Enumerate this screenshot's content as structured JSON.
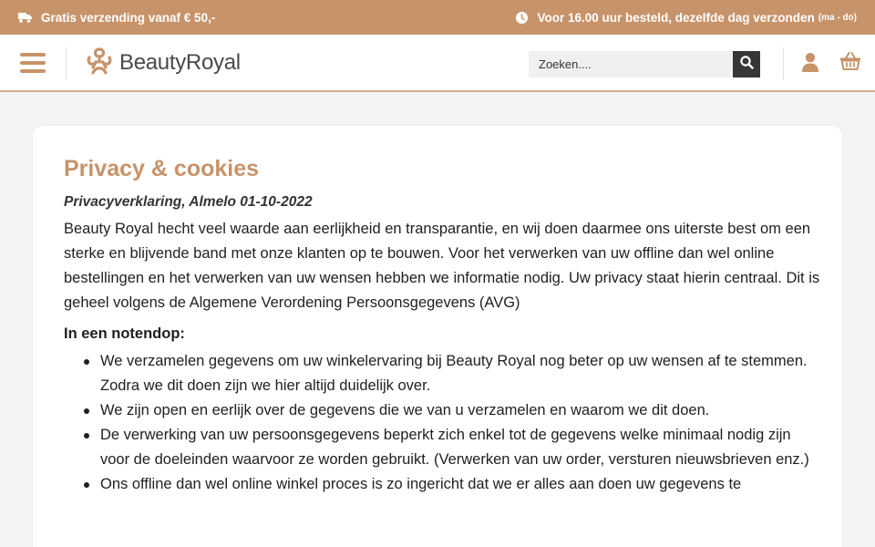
{
  "topbar": {
    "shipping_text": "Gratis verzending vanaf € 50,-",
    "delivery_text": "Voor 16.00 uur besteld, dezelfde dag verzonden",
    "delivery_days": "(ma - do)",
    "icons": [
      "truck-icon",
      "clock-icon"
    ]
  },
  "header": {
    "logo_text": "BeautyRoyal",
    "search": {
      "placeholder": "Zoeken...."
    },
    "icons": [
      "menu-icon",
      "search-icon",
      "user-icon",
      "basket-icon"
    ]
  },
  "colors": {
    "accent": "#c7936a",
    "search_button": "#363636",
    "page_background": "#f3f3f4"
  },
  "page": {
    "title": "Privacy & cookies",
    "subtitle": "Privacyverklaring, Almelo 01-10-2022",
    "intro": "Beauty Royal hecht veel waarde aan eerlijkheid en transparantie, en wij doen daarmee ons uiterste best om een sterke en blijvende band met onze klanten op te bouwen. Voor het verwerken van uw offline dan wel online bestellingen en het verwerken van uw wensen hebben we informatie nodig. Uw privacy staat hierin centraal. Dit is geheel volgens de Algemene Verordening Persoonsgegevens (AVG)",
    "summary_title": "In een notendop:",
    "bullets": [
      "We verzamelen gegevens om uw winkelervaring bij Beauty Royal nog beter op uw wensen af te stemmen. Zodra we dit doen zijn we hier altijd duidelijk over.",
      "We zijn open en eerlijk over de gegevens die we van u verzamelen en waarom we dit doen.",
      "De verwerking van uw persoonsgegevens beperkt zich enkel tot de gegevens welke minimaal nodig zijn voor de doeleinden waarvoor ze worden gebruikt. (Verwerken van uw order, versturen nieuwsbrieven enz.)",
      "Ons offline dan wel online winkel proces is zo ingericht dat we er alles aan doen uw gegevens te"
    ]
  }
}
